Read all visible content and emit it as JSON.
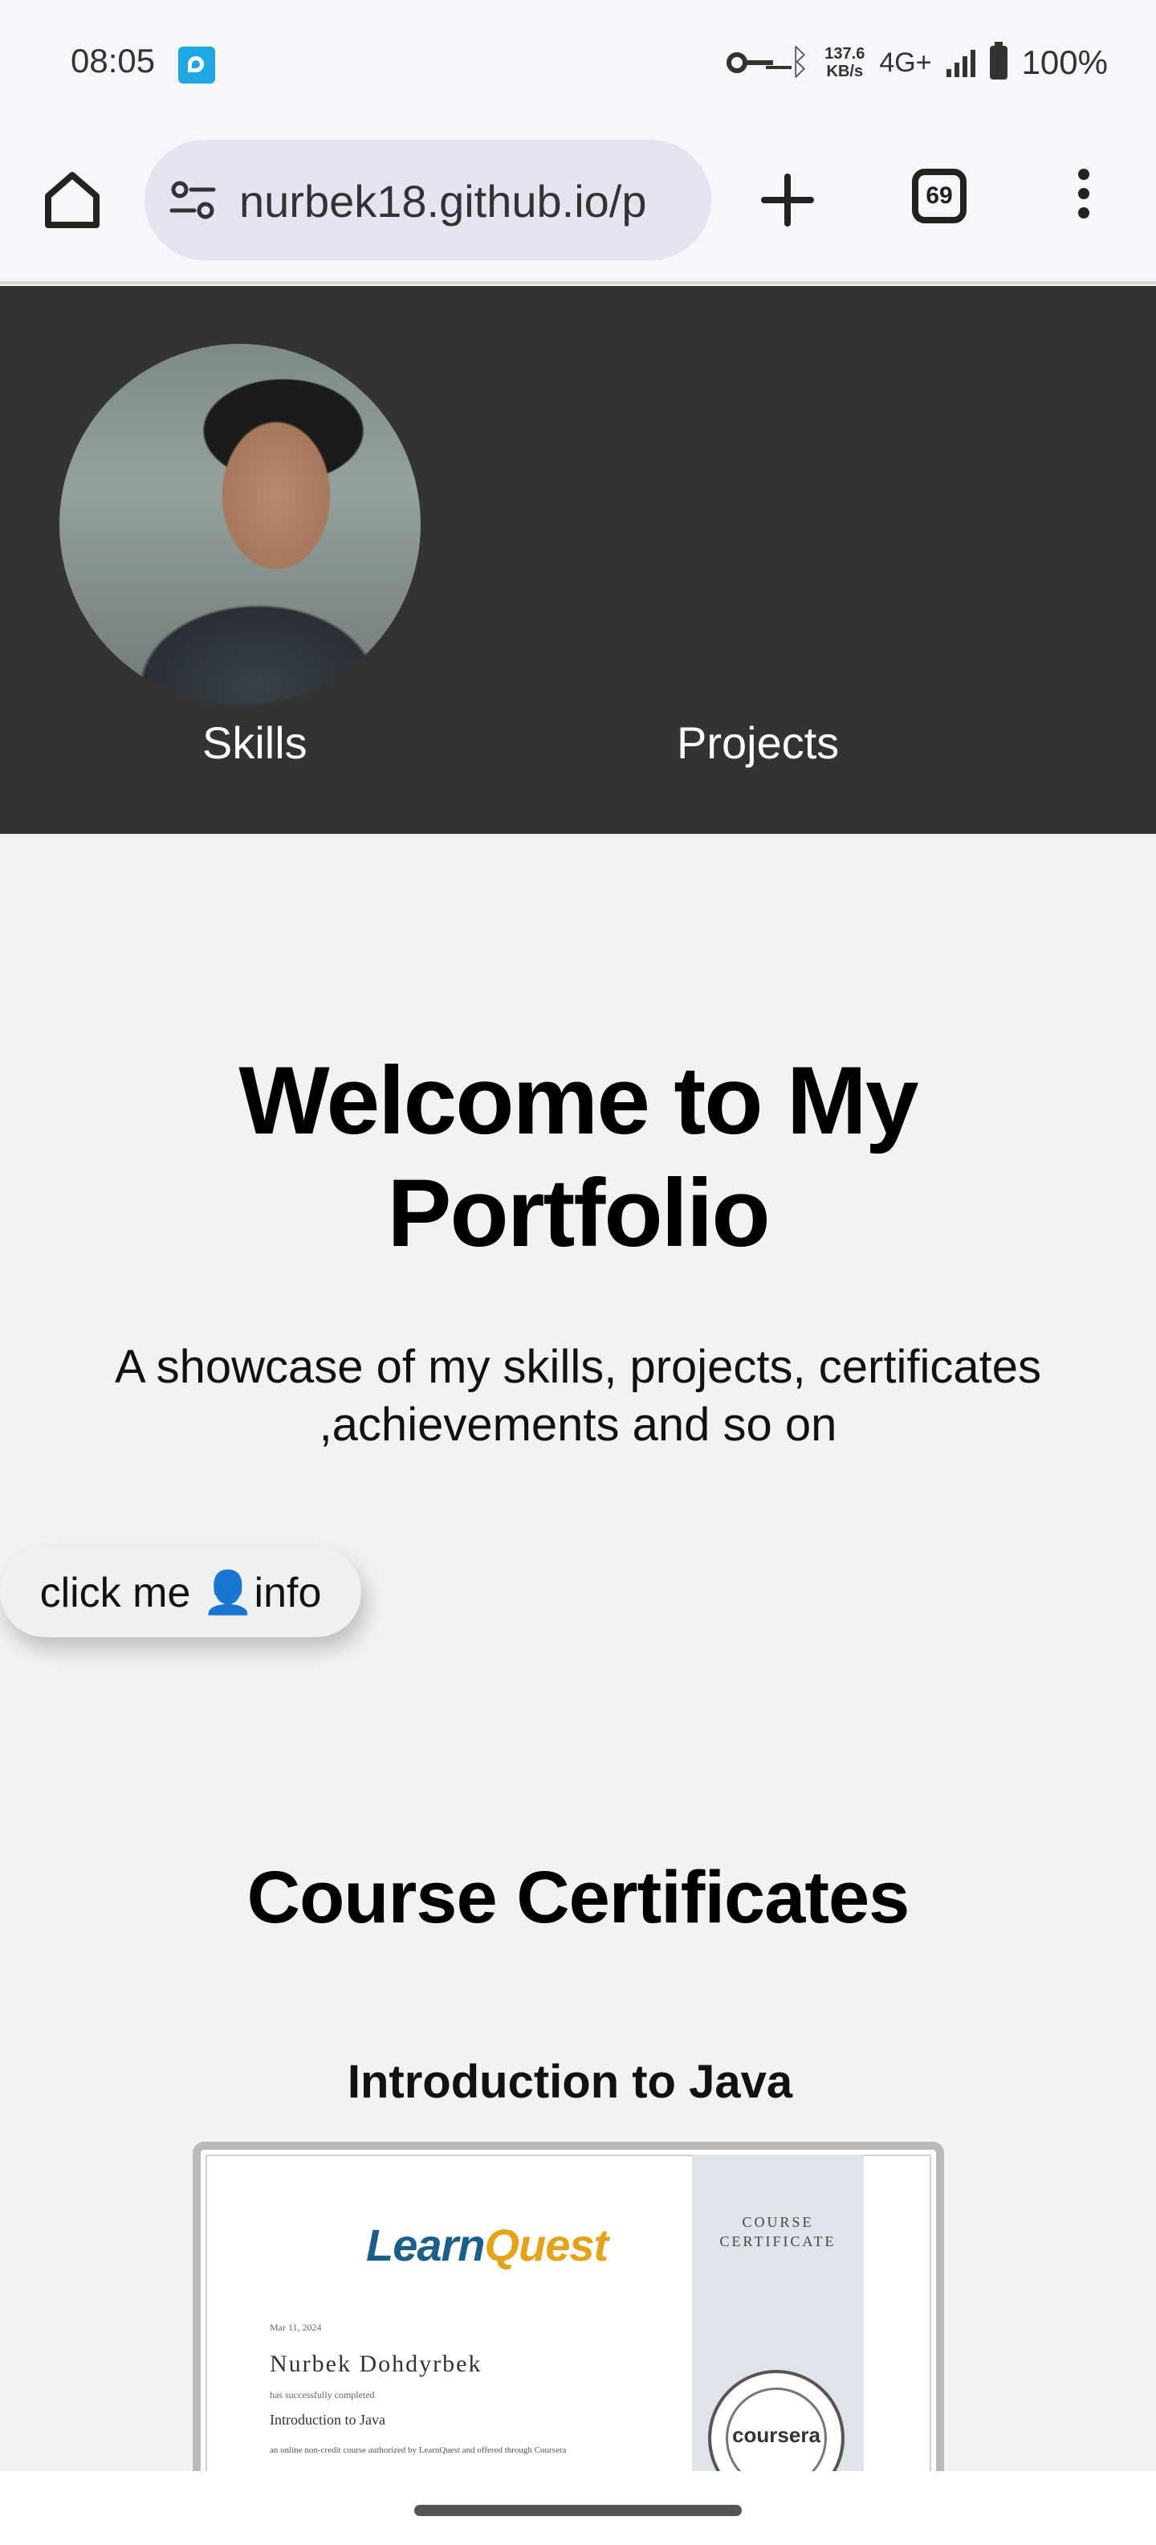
{
  "status_bar": {
    "time": "08:05",
    "net_speed_value": "137.6",
    "net_speed_unit": "KB/s",
    "network_type": "4G+",
    "battery": "100%"
  },
  "browser": {
    "url": "nurbek18.github.io/p",
    "tab_count": "69"
  },
  "header": {
    "nav": [
      {
        "label": "Skills"
      },
      {
        "label": "Projects"
      }
    ]
  },
  "hero": {
    "title": "Welcome to My Portfolio",
    "subtitle": "A showcase of my skills, projects, certificates ,achievements and so on"
  },
  "info_button": {
    "label": "click me 👤info"
  },
  "certificates": {
    "section_title": "Course Certificates",
    "items": [
      {
        "title": "Introduction to Java",
        "image": {
          "logo_a": "Learn",
          "logo_b": "Quest",
          "date": "Mar 11, 2024",
          "name": "Nurbek Dohdyrbek",
          "completed": "has successfully completed",
          "course": "Introduction to Java",
          "description": "an online non-credit course authorized by LearnQuest and offered through Coursera",
          "band_title": "COURSE CERTIFICATE",
          "seal_text": "coursera"
        }
      }
    ]
  },
  "colors": {
    "header_bg": "#333333",
    "page_bg": "#f2f2f2",
    "url_bar_bg": "#e5e4f0",
    "accent_logo": "#1b5e8a"
  }
}
